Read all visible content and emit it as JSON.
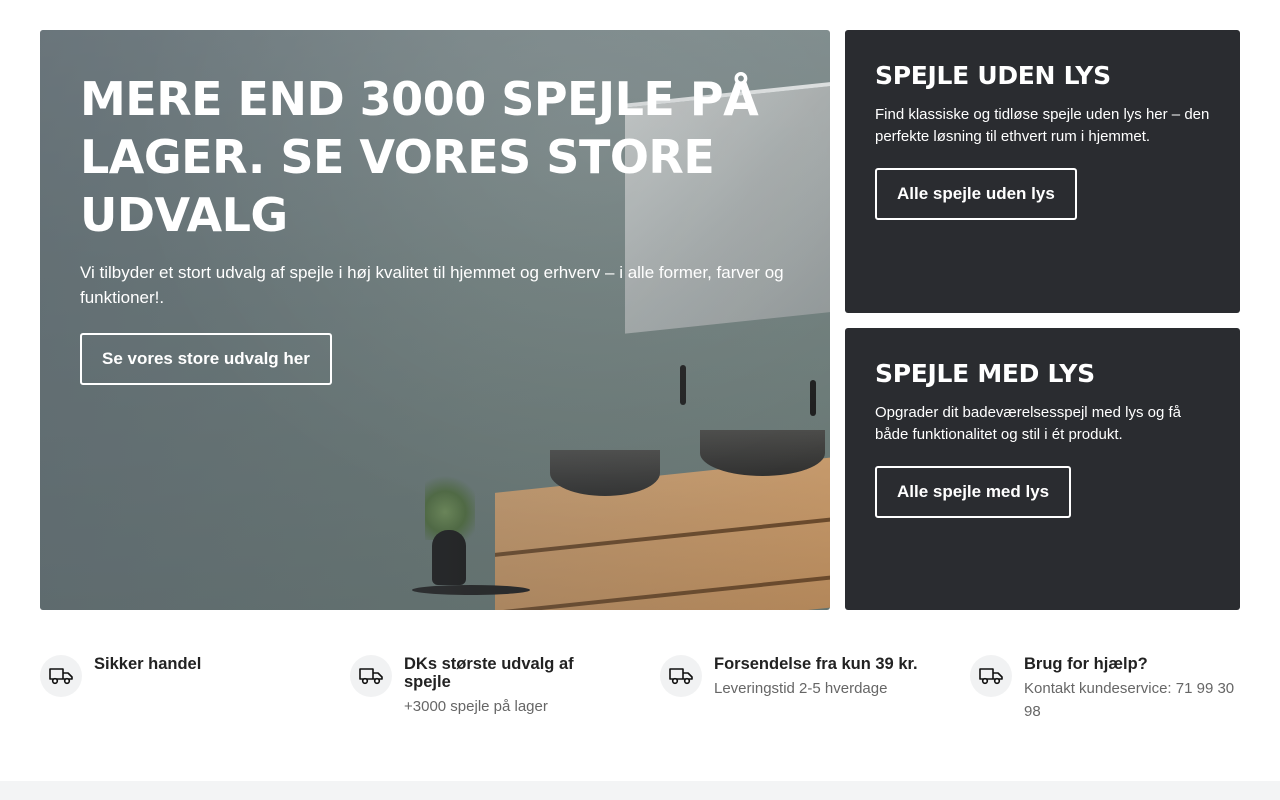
{
  "hero": {
    "title": "MERE END 3000 SPEJLE PÅ LAGER. SE VORES STORE UDVALG",
    "text": "Vi tilbyder et stort udvalg af spejle i høj kvalitet til hjemmet og erhverv – i alle former, farver og funktioner!.",
    "button_label": "Se vores store udvalg her"
  },
  "cards": [
    {
      "title": "SPEJLE UDEN LYS",
      "text": "Find klassiske og tidløse spejle uden lys her – den perfekte løsning til ethvert rum i hjemmet.",
      "button_label": "Alle spejle uden lys"
    },
    {
      "title": "SPEJLE MED LYS",
      "text": "Opgrader dit badeværelsesspejl med lys og få både funktionalitet og stil i ét produkt.",
      "button_label": "Alle spejle med lys"
    }
  ],
  "features": [
    {
      "icon": "truck-icon",
      "title": "Sikker handel",
      "subtitle": ""
    },
    {
      "icon": "truck-icon",
      "title": "DKs største udvalg af spejle",
      "subtitle": "+3000 spejle på lager"
    },
    {
      "icon": "truck-icon",
      "title": "Forsendelse fra kun 39 kr.",
      "subtitle": "Leveringstid 2-5 hverdage"
    },
    {
      "icon": "truck-icon",
      "title": "Brug for hjælp?",
      "subtitle": "Kontakt kundeservice: 71 99 30 98"
    }
  ],
  "colors": {
    "card_background": "#2a2c30",
    "button_border": "#ffffff",
    "icon_circle": "#f1f2f3",
    "footer_strip": "#f3f4f5"
  }
}
